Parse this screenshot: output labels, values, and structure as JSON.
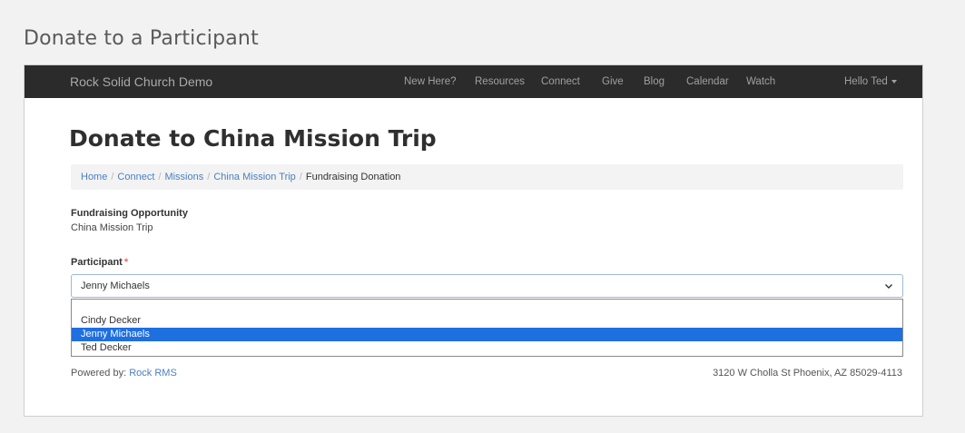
{
  "outer_title": "Donate to a Participant",
  "navbar": {
    "brand": "Rock Solid Church Demo",
    "links": [
      "New Here?",
      "Resources",
      "Connect",
      "Give",
      "Blog",
      "Calendar",
      "Watch"
    ],
    "user_menu": "Hello Ted"
  },
  "page_title": "Donate to China Mission Trip",
  "breadcrumb": {
    "items": [
      "Home",
      "Connect",
      "Missions",
      "China Mission Trip"
    ],
    "current": "Fundraising Donation",
    "separator": "/"
  },
  "fundraising": {
    "label": "Fundraising Opportunity",
    "value": "China Mission Trip"
  },
  "participant": {
    "label": "Participant",
    "required_marker": "*",
    "selected": "Jenny Michaels",
    "options": [
      "Cindy Decker",
      "Jenny Michaels",
      "Ted Decker"
    ]
  },
  "footer": {
    "powered_prefix": "Powered by:",
    "powered_link": "Rock RMS",
    "address": "3120 W Cholla St Phoenix, AZ 85029-4113"
  },
  "colors": {
    "navbar_bg": "#2b2b2b",
    "link": "#4a7fc1",
    "selected_option": "#1e6fe0",
    "required": "#e06d6d"
  }
}
